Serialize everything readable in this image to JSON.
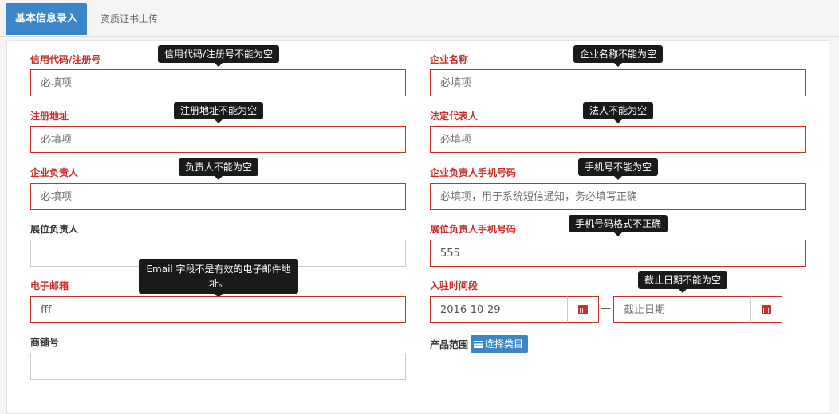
{
  "tabs": [
    {
      "label": "基本信息录入",
      "active": true
    },
    {
      "label": "资质证书上传",
      "active": false
    }
  ],
  "form": {
    "credit_code": {
      "label": "信用代码/注册号",
      "placeholder": "必填项",
      "value": "",
      "error": "信用代码/注册号不能为空"
    },
    "company_name": {
      "label": "企业名称",
      "placeholder": "必填项",
      "value": "",
      "error": "企业名称不能为空"
    },
    "reg_address": {
      "label": "注册地址",
      "placeholder": "必填项",
      "value": "",
      "error": "注册地址不能为空"
    },
    "legal_rep": {
      "label": "法定代表人",
      "placeholder": "必填项",
      "value": "",
      "error": "法人不能为空"
    },
    "company_manager": {
      "label": "企业负责人",
      "placeholder": "必填项",
      "value": "",
      "error": "负责人不能为空"
    },
    "company_manager_phone": {
      "label": "企业负责人手机号码",
      "placeholder": "必填项，用于系统短信通知，务必填写正确",
      "value": "",
      "error": "手机号不能为空"
    },
    "booth_manager": {
      "label": "展位负责人",
      "placeholder": "",
      "value": ""
    },
    "booth_manager_phone": {
      "label": "展位负责人手机号码",
      "value": "555",
      "error": "手机号码格式不正确"
    },
    "email": {
      "label": "电子邮箱",
      "value": "fff",
      "error": "Email 字段不是有效的电子邮件地址。"
    },
    "entry_time": {
      "label": "入驻时间段",
      "start": "2016-10-29",
      "end_placeholder": "截止日期",
      "separator": "—",
      "error": "截止日期不能为空"
    },
    "shop_no": {
      "label": "商铺号",
      "value": ""
    },
    "product_scope": {
      "label": "产品范围",
      "button": "选择类目"
    }
  },
  "colors": {
    "accent": "#3a86c8",
    "error": "#c9302c"
  }
}
